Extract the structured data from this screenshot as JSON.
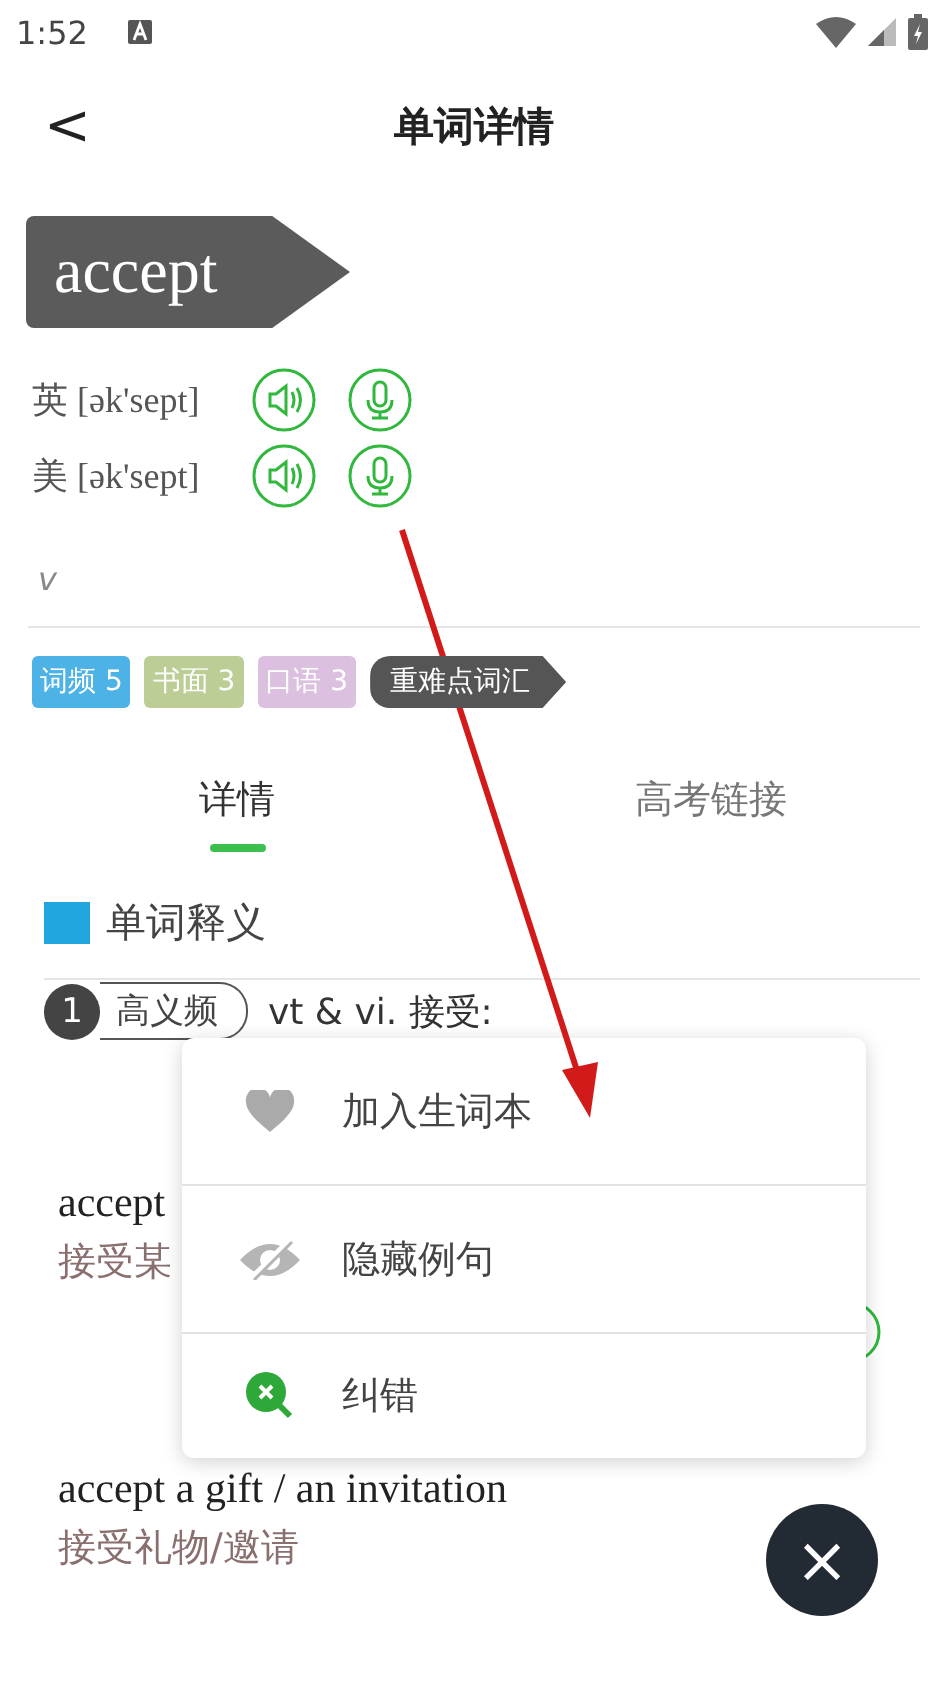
{
  "status_bar": {
    "time": "1:52"
  },
  "header": {
    "back": "<",
    "title": "单词详情"
  },
  "word": "accept",
  "pronunciations": [
    {
      "region": "英",
      "phonetic": "[ək'sept]"
    },
    {
      "region": "美",
      "phonetic": "[ək'sept]"
    }
  ],
  "part_of_speech": "v",
  "tags": [
    {
      "label": "词频 5",
      "color": "#4db3e6",
      "kind": "chip"
    },
    {
      "label": "书面 3",
      "color": "#bccd96",
      "kind": "chip"
    },
    {
      "label": "口语 3",
      "color": "#dcc0e0",
      "kind": "chip"
    },
    {
      "label": "重难点词汇",
      "color": "#555555",
      "kind": "arrow"
    }
  ],
  "tabs": [
    {
      "label": "详情",
      "selected": true
    },
    {
      "label": "高考链接",
      "selected": false
    }
  ],
  "section_title": "单词释义",
  "sense": {
    "number": "1",
    "frequency": "高义频",
    "definition": "vt & vi. 接受:"
  },
  "examples": [
    {
      "en": "accept",
      "zh": "接受某"
    },
    {
      "en": "accept a gift / an invitation",
      "zh": "接受礼物/邀请"
    }
  ],
  "menu": [
    {
      "label": "加入生词本",
      "kind": "heart"
    },
    {
      "label": "隐藏例句",
      "kind": "hide"
    },
    {
      "label": "纠错",
      "kind": "correct"
    }
  ],
  "fab": "×"
}
